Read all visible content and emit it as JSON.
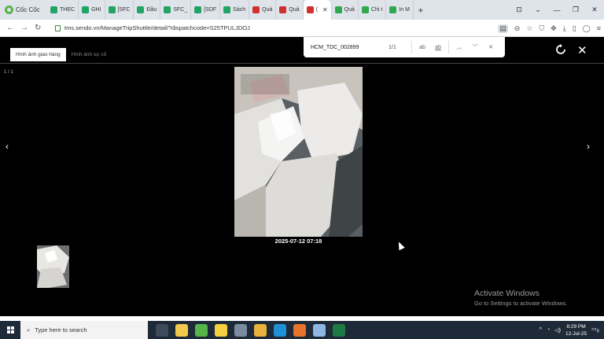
{
  "browser": {
    "brand": "Cốc Cốc",
    "tabs": [
      {
        "label": "THEC",
        "color": "#21a464"
      },
      {
        "label": "GHI",
        "color": "#21a464"
      },
      {
        "label": "[SFC",
        "color": "#21a464"
      },
      {
        "label": "Đầu",
        "color": "#21a464"
      },
      {
        "label": "SFC_",
        "color": "#21a464"
      },
      {
        "label": "[SDF",
        "color": "#21a464"
      },
      {
        "label": "Sách",
        "color": "#21a464"
      },
      {
        "label": "Quả",
        "color": "#d0312d"
      },
      {
        "label": "Quả",
        "color": "#d0312d"
      },
      {
        "label": "(",
        "color": "#d0312d"
      },
      {
        "label": "Quả",
        "color": "#2fa84f"
      },
      {
        "label": "Chi t",
        "color": "#2fa84f"
      },
      {
        "label": "In M",
        "color": "#2fa84f"
      }
    ],
    "new_tab": "+",
    "url": "tms.sendo.vn/ManageTripShuttle/detail/?dispatchcode=S25TPULJDOJ"
  },
  "find": {
    "query": "HCM_TDC_002899",
    "count": "1/1",
    "match_case": "ab",
    "whole_word": "ab"
  },
  "viewer": {
    "tab_delivery": "Hình ảnh giao hàng",
    "tab_incident": "Hình ảnh sự cố",
    "counter": "1 / 1",
    "prev": "‹",
    "next": "›",
    "caption": "2025-07-12 07:18",
    "close": "✕"
  },
  "watermark": {
    "line1": "Activate Windows",
    "line2": "Go to Settings to activate Windows."
  },
  "taskbar": {
    "search_placeholder": "Type here to search",
    "time": "8:29 PM",
    "date": "12-Jul-25",
    "notifications": "5",
    "apps": [
      {
        "name": "task-view",
        "color": "#3d4a5c"
      },
      {
        "name": "file-explorer",
        "color": "#f2c94c"
      },
      {
        "name": "coccoc",
        "color": "#56b44a"
      },
      {
        "name": "sticky-notes",
        "color": "#f5d142"
      },
      {
        "name": "coccoc-alt",
        "color": "#7a8ba0"
      },
      {
        "name": "chrome",
        "color": "#e8b13c"
      },
      {
        "name": "edge",
        "color": "#1f8fd6"
      },
      {
        "name": "firefox",
        "color": "#e8742b"
      },
      {
        "name": "notepad",
        "color": "#8fb6e0"
      },
      {
        "name": "excel",
        "color": "#1d7a45"
      }
    ]
  }
}
